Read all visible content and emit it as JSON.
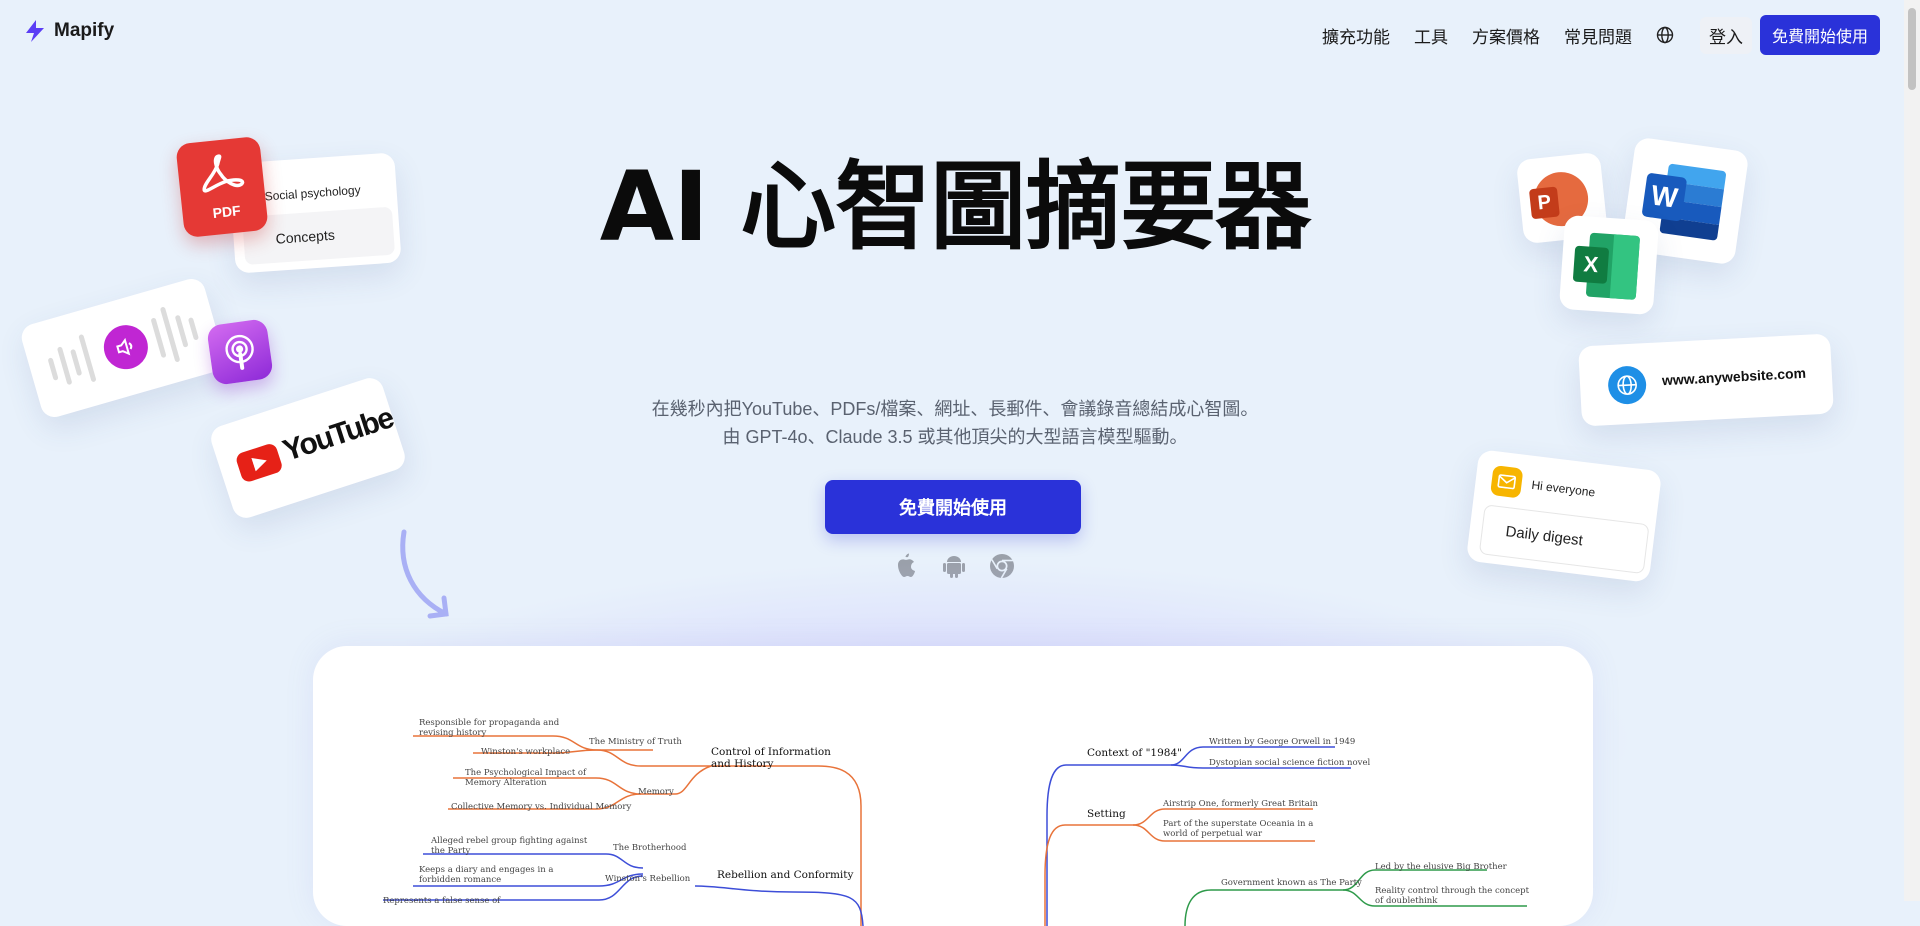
{
  "header": {
    "brand": "Mapify",
    "nav": [
      "擴充功能",
      "工具",
      "方案價格",
      "常見問題"
    ],
    "login_label": "登入",
    "cta_label": "免費開始使用"
  },
  "hero": {
    "title": "AI 心智圖摘要器",
    "subtitle_line1": "在幾秒內把YouTube、PDFs/檔案、網址、長郵件、會議錄音總結成心智圖。",
    "subtitle_line2": "由 GPT-4o、Claude 3.5 或其他頂尖的大型語言模型驅動。",
    "cta_label": "免費開始使用",
    "platforms": [
      "apple-icon",
      "android-icon",
      "chrome-icon"
    ]
  },
  "cards": {
    "pdf_label": "PDF",
    "pdf_line1": "Social psychology",
    "pdf_line2": "Concepts",
    "youtube_label": "YouTube",
    "website_label": "www.anywebsite.com",
    "email_line1": "Hi everyone",
    "email_line2": "Daily digest"
  },
  "mindmap": {
    "left_branches": [
      {
        "title": "Control of Information and History",
        "color": "#e8733a",
        "nodes": [
          {
            "label": "The Ministry of Truth",
            "children": [
              "Responsible for propaganda and revising history",
              "Winston's workplace"
            ]
          },
          {
            "label": "Memory",
            "children": [
              "The Psychological Impact of Memory Alteration",
              "Collective Memory vs. Individual Memory"
            ]
          }
        ]
      },
      {
        "title": "Rebellion and Conformity",
        "color": "#3d4ed8",
        "nodes": [
          {
            "label": "The Brotherhood",
            "children": [
              "Alleged rebel group fighting against the Party"
            ]
          },
          {
            "label": "Winston's Rebellion",
            "children": [
              "Keeps a diary and engages in a forbidden romance",
              "Represents a false sense of"
            ]
          }
        ]
      }
    ],
    "right_branches": [
      {
        "title": "Context of \"1984\"",
        "color": "#3d4ed8",
        "children": [
          "Written by George Orwell in 1949",
          "Dystopian social science fiction novel"
        ]
      },
      {
        "title": "Setting",
        "color": "#e8733a",
        "children": [
          "Airstrip One, formerly Great Britain",
          "Part of the superstate Oceania in a world of perpetual war"
        ]
      },
      {
        "title": "Government known as The Party",
        "color": "#2e9a4a",
        "children": [
          "Led by the elusive Big Brother",
          "Reality control through the concept of doublethink"
        ]
      }
    ]
  },
  "colors": {
    "background": "#e8f1fb",
    "accent": "#2a32d9",
    "orange_branch": "#e8733a",
    "blue_branch": "#3d4ed8",
    "green_branch": "#2e9a4a"
  }
}
